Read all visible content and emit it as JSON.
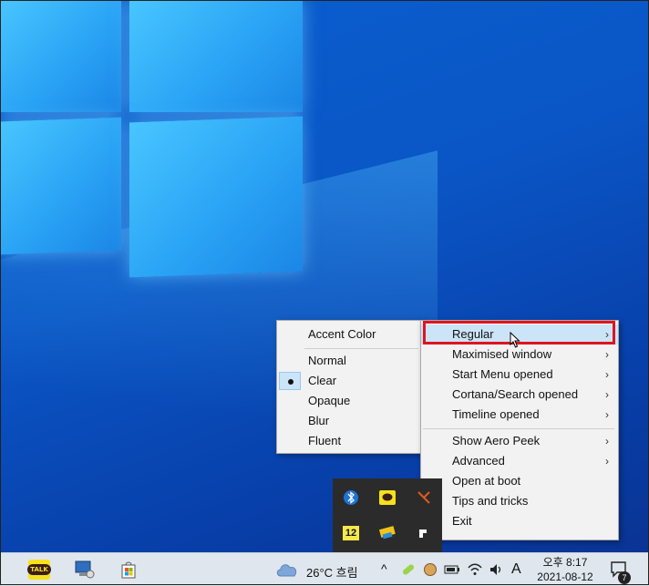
{
  "submenu_left": {
    "header": "Accent Color",
    "items": [
      "Normal",
      "Clear",
      "Opaque",
      "Blur",
      "Fluent"
    ],
    "selected": "Clear"
  },
  "main_menu": {
    "groups": [
      [
        "Regular",
        "Maximised window",
        "Start Menu opened",
        "Cortana/Search opened",
        "Timeline opened"
      ],
      [
        "Show Aero Peek",
        "Advanced",
        "Open at boot",
        "Tips and tricks",
        "Exit"
      ]
    ],
    "submenu_marker": "›"
  },
  "tray": {
    "overflow_badge": "12",
    "weather": "26°C 흐림",
    "ime": "A",
    "time": "오후 8:17",
    "date": "2021-08-12",
    "notification_count": "7",
    "chevron": "^"
  },
  "taskbar": {
    "kakao_label": "TALK"
  }
}
